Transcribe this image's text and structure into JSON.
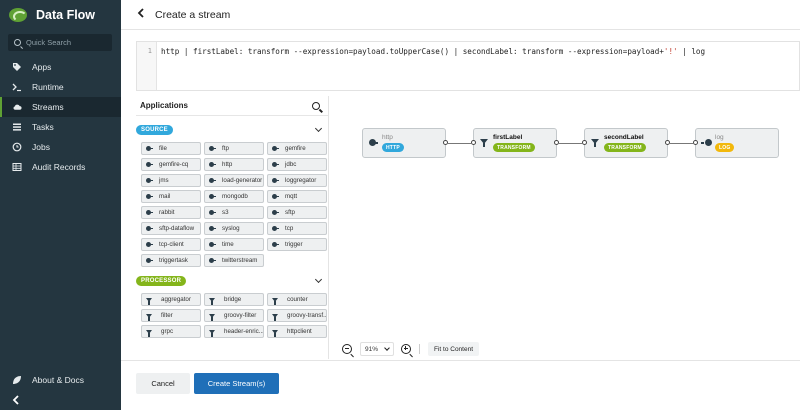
{
  "app": {
    "title": "Data Flow"
  },
  "sidebar": {
    "search_placeholder": "Quick Search",
    "items": [
      {
        "label": "Apps",
        "icon": "tag-icon"
      },
      {
        "label": "Runtime",
        "icon": "terminal-icon"
      },
      {
        "label": "Streams",
        "icon": "cloud-icon",
        "active": true
      },
      {
        "label": "Tasks",
        "icon": "list-icon"
      },
      {
        "label": "Jobs",
        "icon": "clock-icon"
      },
      {
        "label": "Audit Records",
        "icon": "table-icon"
      }
    ],
    "about_label": "About & Docs",
    "collapse_icon": "chevron-left-icon"
  },
  "header": {
    "title": "Create a stream"
  },
  "editor": {
    "line_number": "1",
    "code_before": "http | firstLabel: transform --expression=payload.toUpperCase() | secondLabel: transform --expression=payload+",
    "code_string": "'!'",
    "code_after": " | log"
  },
  "palette": {
    "title": "Applications",
    "groups": [
      {
        "label": "SOURCE",
        "color": "#31a8dc",
        "items": [
          "file",
          "ftp",
          "gemfire",
          "gemfire-cq",
          "http",
          "jdbc",
          "jms",
          "load-generator",
          "loggregator",
          "mail",
          "mongodb",
          "mqtt",
          "rabbit",
          "s3",
          "sftp",
          "sftp-dataflow",
          "syslog",
          "tcp",
          "tcp-client",
          "time",
          "trigger",
          "triggertask",
          "twitterstream"
        ]
      },
      {
        "label": "PROCESSOR",
        "color": "#84b51b",
        "items": [
          "aggregator",
          "bridge",
          "counter",
          "filter",
          "groovy-filter",
          "groovy-transf...",
          "grpc",
          "header-enric...",
          "httpclient"
        ]
      }
    ]
  },
  "canvas": {
    "nodes": [
      {
        "name": "http",
        "tag": "HTTP",
        "kind": "source",
        "tag_color": "#31a8dc"
      },
      {
        "name": "firstLabel",
        "tag": "TRANSFORM",
        "kind": "processor",
        "tag_color": "#84b51b"
      },
      {
        "name": "secondLabel",
        "tag": "TRANSFORM",
        "kind": "processor",
        "tag_color": "#84b51b"
      },
      {
        "name": "log",
        "tag": "LOG",
        "kind": "sink",
        "tag_color": "#f2b80c"
      }
    ],
    "zoom": "91%",
    "fit_label": "Fit to Content"
  },
  "footer": {
    "cancel_label": "Cancel",
    "create_label": "Create Stream(s)"
  }
}
